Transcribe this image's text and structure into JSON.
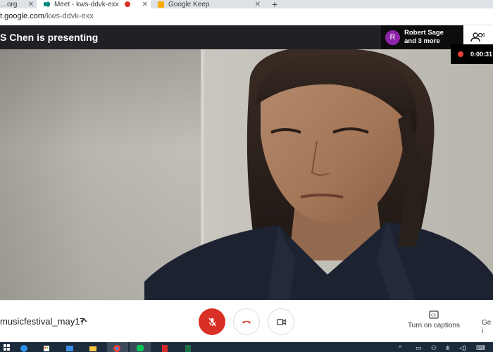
{
  "browser": {
    "tabs": [
      {
        "label": "…org",
        "favicon": "unknown-icon",
        "has_close": true
      },
      {
        "label": "Meet - kws-ddvk-exx",
        "favicon": "meet-icon",
        "recording": true,
        "has_close": true,
        "active": true
      },
      {
        "label": "Google Keep",
        "favicon": "keep-icon",
        "has_close": true
      }
    ],
    "new_tab_label": "+",
    "address": {
      "host": "t.google.com",
      "path": "/kws-ddvk-exx"
    }
  },
  "meet": {
    "presenting_text": "S Chen is presenting",
    "participants": {
      "avatar_initial": "R",
      "name": "Robert Sage",
      "more": "and 3 more",
      "count": "6",
      "avatar_color": "#8e24aa"
    },
    "timer": "0:00:31",
    "meeting_name": "musicfestival_may17",
    "controls": {
      "mic_state": "muted",
      "captions_label": "Turn on captions",
      "present_partial_line1": "Ge",
      "present_partial_line2": "i"
    }
  },
  "colors": {
    "header_bg": "#202124",
    "mic_red": "#d93025",
    "hangup_red": "#d93025",
    "rec_red": "#ea4335",
    "taskbar": "#1b2b3c"
  },
  "taskbar_icons": [
    "windows-start-icon",
    "edge-icon",
    "store-icon",
    "mail-icon",
    "file-explorer-icon",
    "chrome-icon",
    "line-app-icon",
    "acrobat-icon",
    "excel-icon"
  ]
}
